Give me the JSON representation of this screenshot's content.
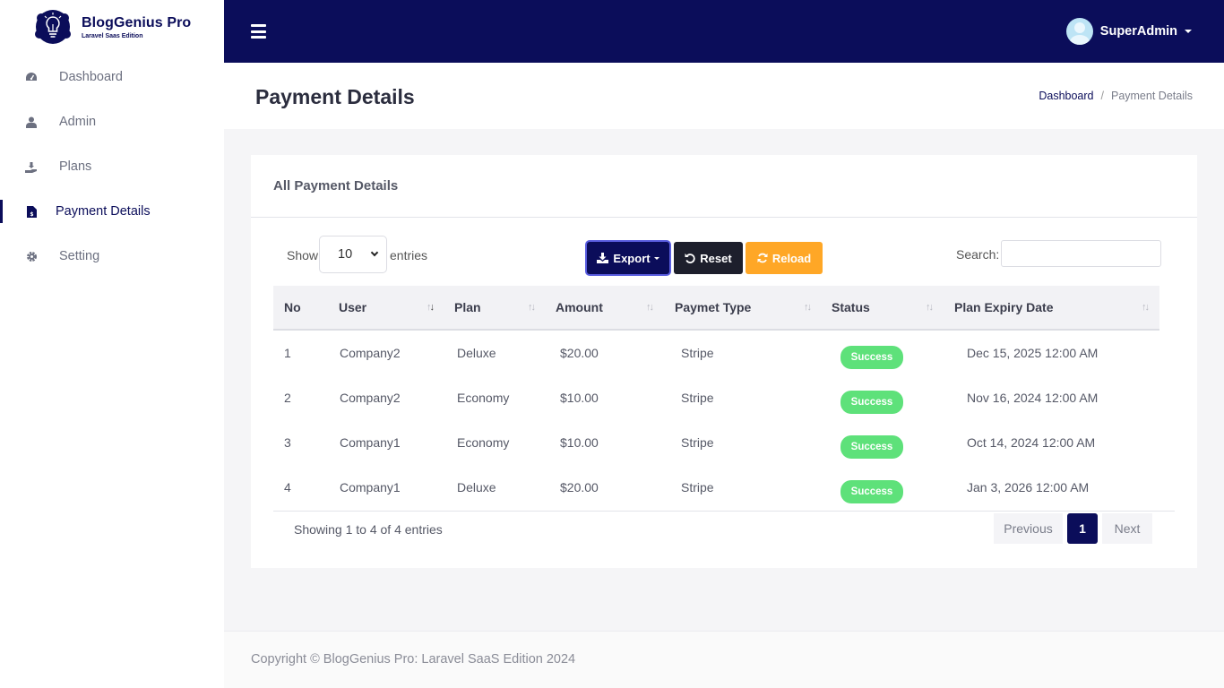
{
  "brand": {
    "name": "BlogGenius Pro",
    "subtitle": "Laravel Saas Edition"
  },
  "sidebar": {
    "items": [
      {
        "label": "Dashboard",
        "icon": "dashboard-icon",
        "active": false
      },
      {
        "label": "Admin",
        "icon": "user-icon",
        "active": false
      },
      {
        "label": "Plans",
        "icon": "plans-icon",
        "active": false
      },
      {
        "label": "Payment Details",
        "icon": "invoice-icon",
        "active": true
      },
      {
        "label": "Setting",
        "icon": "gear-icon",
        "active": false
      }
    ]
  },
  "topbar": {
    "user_name": "SuperAdmin"
  },
  "page": {
    "title": "Payment Details",
    "breadcrumb": {
      "home": "Dashboard",
      "separator": "/",
      "current": "Payment Details"
    }
  },
  "card": {
    "title": "All Payment Details",
    "length": {
      "show": "Show",
      "value": "10",
      "entries": "entries"
    },
    "buttons": {
      "export": "Export",
      "reset": "Reset",
      "reload": "Reload"
    },
    "search": {
      "label": "Search:",
      "value": ""
    },
    "table": {
      "columns": [
        "No",
        "User",
        "Plan",
        "Amount",
        "Paymet Type",
        "Status",
        "Plan Expiry Date"
      ],
      "rows": [
        {
          "no": "1",
          "user": "Company2",
          "plan": "Deluxe",
          "amount": "$20.00",
          "type": "Stripe",
          "status": "Success",
          "expiry": "Dec 15, 2025 12:00 AM"
        },
        {
          "no": "2",
          "user": "Company2",
          "plan": "Economy",
          "amount": "$10.00",
          "type": "Stripe",
          "status": "Success",
          "expiry": "Nov 16, 2024 12:00 AM"
        },
        {
          "no": "3",
          "user": "Company1",
          "plan": "Economy",
          "amount": "$10.00",
          "type": "Stripe",
          "status": "Success",
          "expiry": "Oct 14, 2024 12:00 AM"
        },
        {
          "no": "4",
          "user": "Company1",
          "plan": "Deluxe",
          "amount": "$20.00",
          "type": "Stripe",
          "status": "Success",
          "expiry": "Jan 3, 2026 12:00 AM"
        }
      ]
    },
    "info": "Showing 1 to 4 of 4 entries",
    "pagination": {
      "previous": "Previous",
      "current": "1",
      "next": "Next"
    }
  },
  "footer": {
    "text": "Copyright © BlogGenius Pro: Laravel SaaS Edition 2024"
  },
  "colors": {
    "primary": "#0b0d5a",
    "success": "#5ee17a",
    "warning": "#ffa726",
    "dark": "#1d1f2c"
  }
}
